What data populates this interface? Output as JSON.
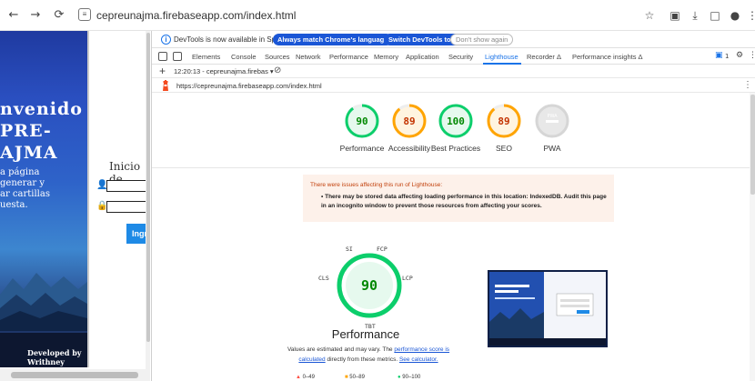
{
  "browser": {
    "url": "cepreunajma.firebaseapp.com/index.html",
    "icons": [
      "back-icon",
      "forward-icon",
      "reload-icon",
      "site-info-icon",
      "star-icon",
      "extensions-icon",
      "download-icon",
      "tab-search-icon",
      "profile-icon",
      "menu-icon"
    ]
  },
  "site": {
    "welcome_lines": [
      "nvenido",
      "PRE-",
      "AJMA"
    ],
    "description_lines": [
      "a página",
      "generar y",
      "ar cartillas",
      "uesta."
    ],
    "login_title": "Inicio de",
    "login_button": "Ingr",
    "footer": "Developed by Writhney"
  },
  "devtools": {
    "info_text": "DevTools is now available in Spanish!",
    "info_buttons": [
      "Always match Chrome's language",
      "Switch DevTools to Spanish",
      "Don't show again"
    ],
    "tabs": [
      "Elements",
      "Console",
      "Sources",
      "Network",
      "Performance",
      "Memory",
      "Application",
      "Security",
      "Lighthouse",
      "Recorder",
      "Performance insights"
    ],
    "active_tab": "Lighthouse",
    "recorder_symbol": "Δ",
    "issues_count": "1",
    "report_select": "12:20:13 - cepreunajma.firebas ▾",
    "report_url": "https://cepreunajma.firebaseapp.com/index.html"
  },
  "scores": [
    {
      "label": "Performance",
      "value": "90",
      "color": "#0cce6b"
    },
    {
      "label": "Accessibility",
      "value": "89",
      "color": "#ffa400"
    },
    {
      "label": "Best Practices",
      "value": "100",
      "color": "#0cce6b"
    },
    {
      "label": "SEO",
      "value": "89",
      "color": "#ffa400"
    },
    {
      "label": "PWA",
      "value": "PWA",
      "color": "#9e9e9e"
    }
  ],
  "warning": {
    "title": "There were issues affecting this run of Lighthouse:",
    "bullet": "There may be stored data affecting loading performance in this location: IndexedDB. Audit this page in an incognito window to prevent those resources from affecting your scores."
  },
  "performance": {
    "score": "90",
    "label": "Performance",
    "metrics": [
      "SI",
      "FCP",
      "LCP",
      "TBT",
      "CLS"
    ],
    "note_pre": "Values are estimated and may vary. The ",
    "note_link1": "performance score is calculated",
    "note_mid": " directly from these metrics. ",
    "note_link2": "See calculator.",
    "legend": [
      "0–49",
      "50–89",
      "90–100"
    ]
  }
}
